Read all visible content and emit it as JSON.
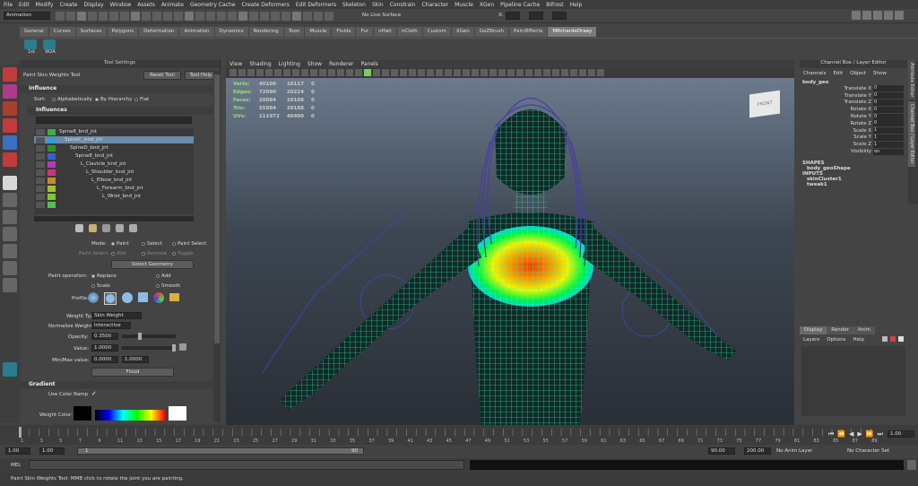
{
  "menubar": [
    "File",
    "Edit",
    "Modify",
    "Create",
    "Display",
    "Window",
    "Assets",
    "Animate",
    "Geometry Cache",
    "Create Deformers",
    "Edit Deformers",
    "Skeleton",
    "Skin",
    "Constrain",
    "Character",
    "Muscle",
    "XGen",
    "Pipeline Cache",
    "Bifrost",
    "Help"
  ],
  "statusline": {
    "mode": "Animation",
    "live_surface": "No Live Surface",
    "x_label": "X:",
    "y_label": "Y:",
    "z_label": "Z:"
  },
  "shelf_tabs": [
    "General",
    "Curves",
    "Surfaces",
    "Polygons",
    "Deformation",
    "Animation",
    "Dynamics",
    "Rendering",
    "Toon",
    "Muscle",
    "Fluids",
    "Fur",
    "nHair",
    "nCloth",
    "Custom",
    "XGen",
    "GoZBrush",
    "PaintEffects",
    "MRchardeDraey"
  ],
  "shelf_active": "MRchardeDraey",
  "shelf_items": [
    "1st",
    "W2A"
  ],
  "tool_settings": {
    "panel_title": "Tool Settings",
    "tool_name": "Paint Skin Weights Tool",
    "reset_label": "Reset Tool",
    "help_label": "Tool Help",
    "influence_section": "Influence",
    "sort_label": "Sort:",
    "sort_options": [
      "Alphabetically",
      "By Hierarchy",
      "Flat"
    ],
    "influences_label": "Influences",
    "influences": [
      {
        "name": "Spine8_bnd_jnt",
        "color": "#3fae3f",
        "indent": 0,
        "selected": false
      },
      {
        "name": "SpineC_bnd_jnt",
        "color": "#2e9fd6",
        "indent": 1,
        "selected": true
      },
      {
        "name": "SpineD_bnd_jnt",
        "color": "#2f8f2f",
        "indent": 2,
        "selected": false
      },
      {
        "name": "Spine8_bnd_jnt",
        "color": "#3b5fd0",
        "indent": 3,
        "selected": false
      },
      {
        "name": "L_Clavicle_bnd_jnt",
        "color": "#b53bb5",
        "indent": 4,
        "selected": false
      },
      {
        "name": "L_Shoulder_bnd_jnt",
        "color": "#c63a7a",
        "indent": 5,
        "selected": false
      },
      {
        "name": "L_Elbow_bnd_jnt",
        "color": "#c88a2e",
        "indent": 6,
        "selected": false
      },
      {
        "name": "L_Forearm_bnd_jnt",
        "color": "#a6c030",
        "indent": 7,
        "selected": false
      },
      {
        "name": "L_Wrist_bnd_jnt",
        "color": "#7ec832",
        "indent": 8,
        "selected": false
      },
      {
        "name": "",
        "color": "#4fc24f",
        "indent": 0,
        "selected": false
      }
    ],
    "mode_label": "Mode:",
    "mode_options": [
      "Paint",
      "Select",
      "Paint Select"
    ],
    "paint_select_label": "Paint Select:",
    "paint_select_options": [
      "Add",
      "Remove",
      "Toggle"
    ],
    "select_geometry": "Select Geometry",
    "paint_op_label": "Paint operation:",
    "paint_ops": [
      "Replace",
      "Add",
      "Scale",
      "Smooth"
    ],
    "profile_label": "Profile:",
    "weight_type_label": "Weight Type:",
    "weight_type": "Skin Weight",
    "normalize_label": "Normalize Weights:",
    "normalize": "Interactive",
    "opacity_label": "Opacity:",
    "opacity": "0.3500",
    "value_label": "Value:",
    "value": "1.0000",
    "minmax_label": "Min/Max value:",
    "min": "0.0000",
    "max": "1.0000",
    "flood": "Flood",
    "gradient_section": "Gradient",
    "use_color_ramp": "Use Color Ramp",
    "weight_color_label": "Weight Color:"
  },
  "viewport": {
    "menu": [
      "View",
      "Shading",
      "Lighting",
      "Show",
      "Renderer",
      "Panels"
    ],
    "hud": [
      {
        "label": "Verts:",
        "a": "40109",
        "b": "10117",
        "c": "0"
      },
      {
        "label": "Edges:",
        "a": "72090",
        "b": "20224",
        "c": "0"
      },
      {
        "label": "Faces:",
        "a": "20084",
        "b": "10108",
        "c": "0"
      },
      {
        "label": "Tris:",
        "a": "55984",
        "b": "20188",
        "c": "0"
      },
      {
        "label": "UVs:",
        "a": "111972",
        "b": "40400",
        "c": "0"
      }
    ],
    "viewcube": "FRONT"
  },
  "channel_box": {
    "title": "Channel Box / Layer Editor",
    "menu": [
      "Channels",
      "Edit",
      "Object",
      "Show"
    ],
    "object": "body_geo",
    "attrs": [
      {
        "name": "Translate X",
        "value": "0"
      },
      {
        "name": "Translate Y",
        "value": "0"
      },
      {
        "name": "Translate Z",
        "value": "0"
      },
      {
        "name": "Rotate X",
        "value": "0"
      },
      {
        "name": "Rotate Y",
        "value": "0"
      },
      {
        "name": "Rotate Z",
        "value": "0"
      },
      {
        "name": "Scale X",
        "value": "1"
      },
      {
        "name": "Scale Y",
        "value": "1"
      },
      {
        "name": "Scale Z",
        "value": "1"
      },
      {
        "name": "Visibility",
        "value": "on"
      }
    ],
    "shapes_label": "SHAPES",
    "shape": "body_geoShape",
    "inputs_label": "INPUTS",
    "inputs": [
      "skinCluster1",
      "tweak1"
    ],
    "side_tabs": [
      "Attribute Editor",
      "Channel Box / Layer Editor"
    ]
  },
  "layer_editor": {
    "tabs": [
      "Display",
      "Render",
      "Anim"
    ],
    "menu": [
      "Layers",
      "Options",
      "Help"
    ]
  },
  "timeline": {
    "ticks": [
      "1",
      "2",
      "3",
      "4",
      "5",
      "6",
      "7",
      "8",
      "9",
      "10",
      "11",
      "12",
      "13",
      "14",
      "15",
      "16",
      "17",
      "18",
      "19",
      "20",
      "21",
      "22",
      "23",
      "24",
      "25",
      "26",
      "27",
      "28",
      "29",
      "30",
      "31",
      "32",
      "33",
      "34",
      "35",
      "36",
      "37",
      "38",
      "39",
      "40",
      "41",
      "42",
      "43",
      "44",
      "45",
      "46",
      "47",
      "48",
      "49",
      "50",
      "51",
      "52",
      "53",
      "54",
      "55",
      "56",
      "57",
      "58",
      "59",
      "60",
      "61",
      "62",
      "63",
      "64",
      "65",
      "66",
      "67",
      "68",
      "69",
      "70",
      "71",
      "72",
      "73",
      "74",
      "75",
      "76",
      "77",
      "78",
      "79",
      "80",
      "81",
      "82",
      "83",
      "84",
      "85",
      "86",
      "87",
      "88",
      "89"
    ],
    "current_frame": "1.00"
  },
  "range": {
    "start": "1.00",
    "inner_start": "1.00",
    "slider_start": "1",
    "slider_end": "90",
    "inner_end": "90.00",
    "end": "200.00",
    "anim_layer": "No Anim Layer",
    "char_set": "No Character Set"
  },
  "command": {
    "label": "MEL"
  },
  "helpline": "Paint Skin Weights Tool: MMB click to rotate the joint you are painting."
}
